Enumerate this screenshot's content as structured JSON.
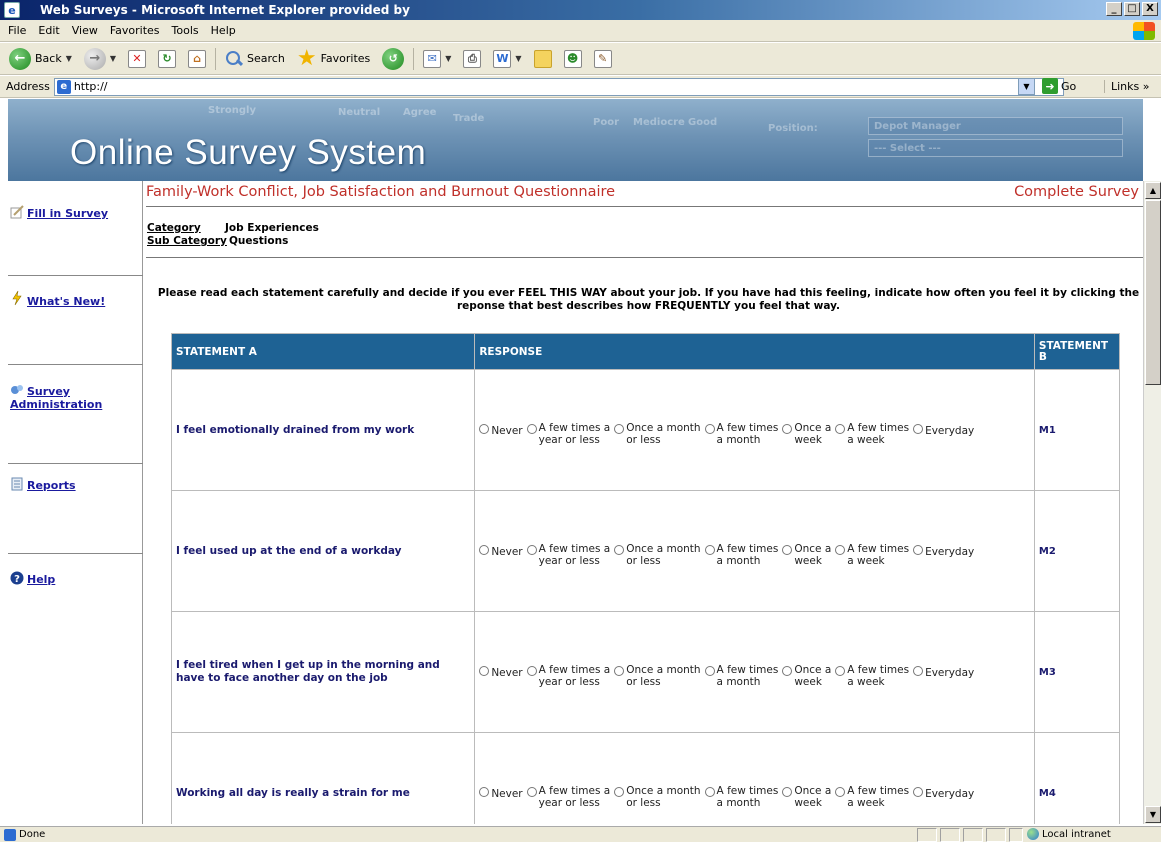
{
  "window": {
    "title": "Web Surveys - Microsoft Internet Explorer provided by",
    "controls": [
      "_",
      "□",
      "X"
    ]
  },
  "menu": [
    "File",
    "Edit",
    "View",
    "Favorites",
    "Tools",
    "Help"
  ],
  "toolbar": {
    "back_label": "Back",
    "search_label": "Search",
    "favorites_label": "Favorites"
  },
  "address": {
    "label": "Address",
    "value": "http://",
    "go_label": "Go",
    "links_label": "Links »"
  },
  "banner": {
    "title": "Online Survey System",
    "ghost_text": [
      "Strongly",
      "Neutral",
      "Agree",
      "Trade",
      "Poor",
      "Mediocre",
      "Good",
      "Position:",
      "Depot Manager",
      "--- Select ---"
    ]
  },
  "sidebar": {
    "items": [
      {
        "label": "Fill in Survey"
      },
      {
        "label": "What's New!"
      },
      {
        "label": "Survey Administration"
      },
      {
        "label": "Reports"
      },
      {
        "label": "Help"
      }
    ]
  },
  "survey": {
    "title": "Family-Work Conflict, Job Satisfaction and Burnout Questionnaire",
    "complete_link": "Complete Survey",
    "category_label": "Category",
    "category_value": "Job Experiences",
    "subcategory_label": "Sub Category",
    "subcategory_value": "Questions",
    "instructions": "Please read each statement carefully and decide if you ever FEEL THIS WAY about your job. If you have had this feeling, indicate how often you feel it by clicking the reponse that best describes how FREQUENTLY you feel that way.",
    "headers": {
      "a": "STATEMENT A",
      "response": "RESPONSE",
      "b": "STATEMENT B"
    },
    "options": [
      {
        "line1": "Never",
        "line2": ""
      },
      {
        "line1": "A few times a",
        "line2": "year or less"
      },
      {
        "line1": "Once a month",
        "line2": "or less"
      },
      {
        "line1": "A few times",
        "line2": "a month"
      },
      {
        "line1": "Once a",
        "line2": "week"
      },
      {
        "line1": "A few times",
        "line2": "a week"
      },
      {
        "line1": "Everyday",
        "line2": ""
      }
    ],
    "rows": [
      {
        "statement": "I feel emotionally drained from my work",
        "code": "M1"
      },
      {
        "statement": "I feel used up at the end of a workday",
        "code": "M2"
      },
      {
        "statement": "I feel tired when I get up in the morning and have to face another day on the job",
        "code": "M3"
      },
      {
        "statement": "Working all day is really a strain for me",
        "code": "M4"
      }
    ]
  },
  "status": {
    "text": "Done",
    "zone": "Local intranet"
  }
}
